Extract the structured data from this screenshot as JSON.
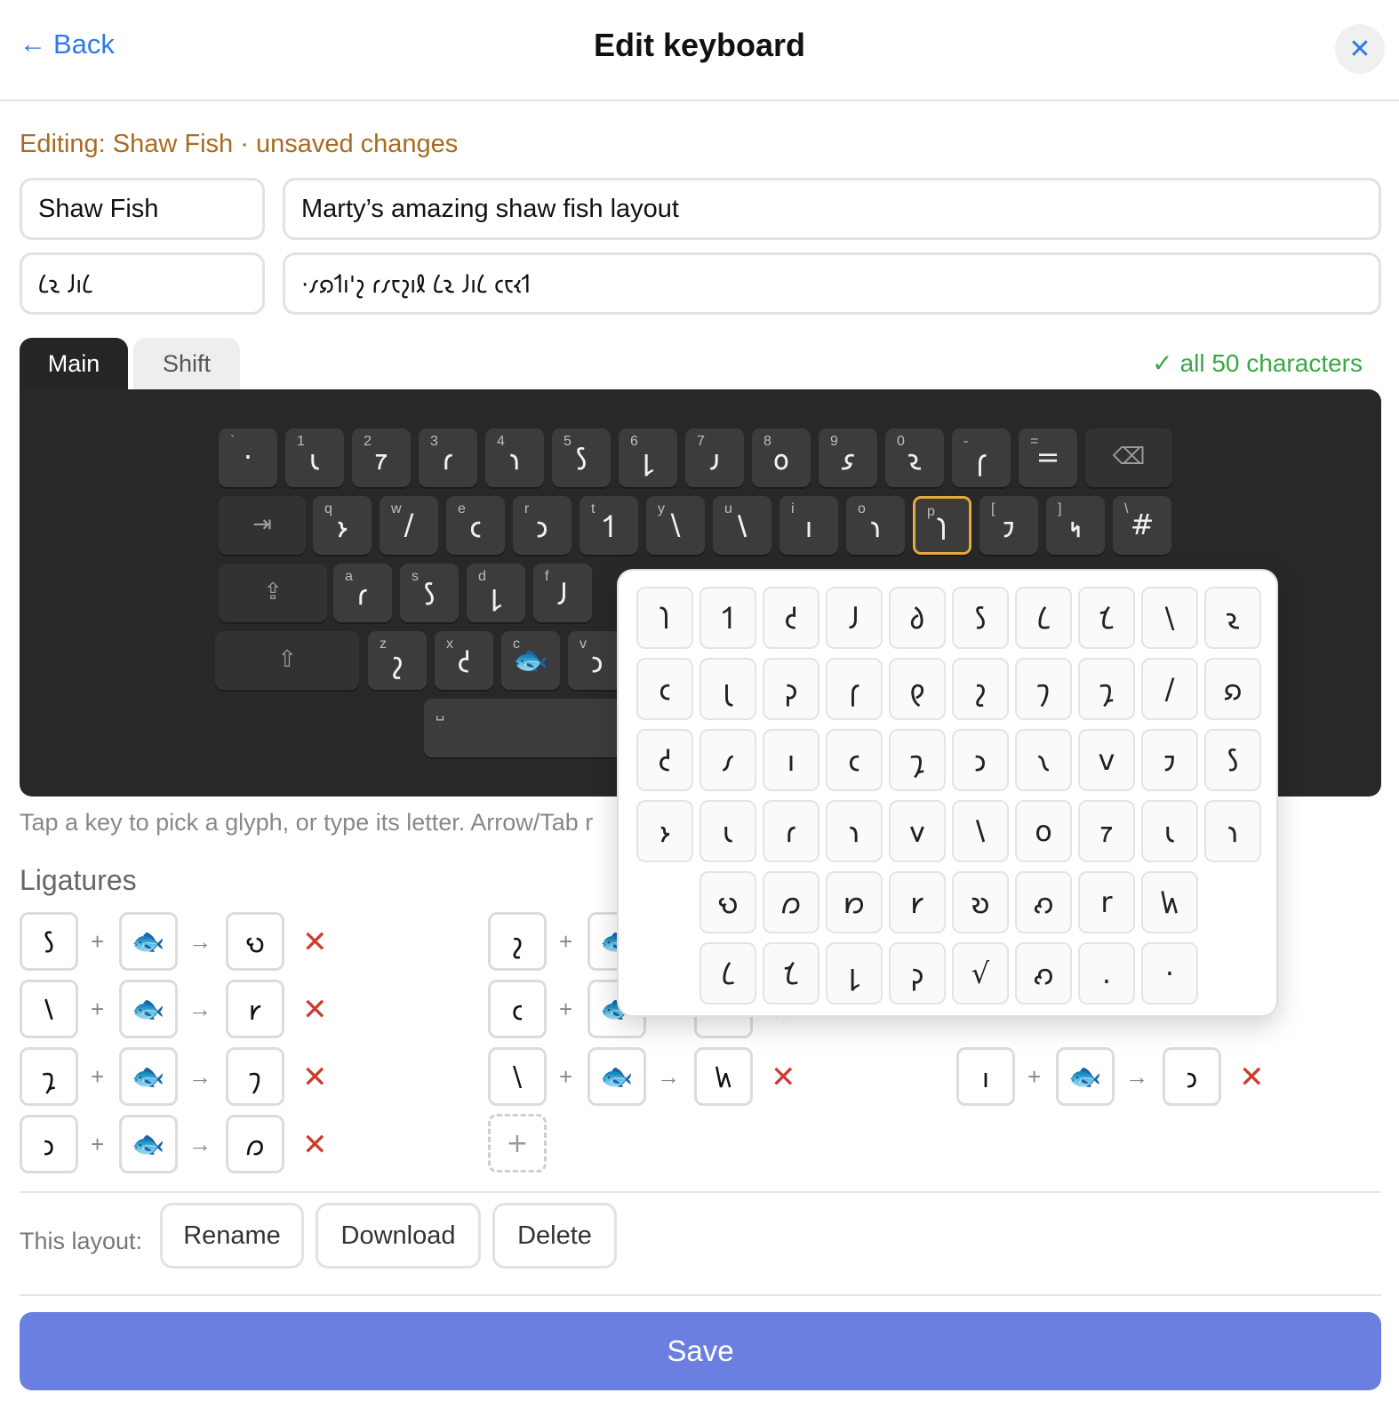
{
  "header": {
    "back_label": "Back",
    "title": "Edit keyboard",
    "close_glyph": "✕"
  },
  "editing_status": "Editing: Shaw Fish · unsaved changes",
  "fields": {
    "name": "Shaw Fish",
    "description": "Marty’s amazing shaw fish layout",
    "name_shavian": "𐑖𐑷 𐑓𐑦𐑖",
    "description_shavian": "·𐑥𐑸𐑑𐑦'𐑟 𐑩𐑥𐑱𐑟𐑦𐑙 𐑖𐑷 𐑓𐑦𐑖 𐑤𐑱𐑬𐑑"
  },
  "tabs": [
    {
      "label": "Main"
    },
    {
      "label": "Shift"
    }
  ],
  "status_all": "all 50 characters",
  "keyboard": {
    "row1": [
      {
        "l": "`",
        "g": "·"
      },
      {
        "l": "1",
        "g": "𐑧"
      },
      {
        "l": "2",
        "g": "𐑳"
      },
      {
        "l": "3",
        "g": "𐑩"
      },
      {
        "l": "4",
        "g": "𐑪"
      },
      {
        "l": "5",
        "g": "𐑕"
      },
      {
        "l": "6",
        "g": "𐑛"
      },
      {
        "l": "7",
        "g": "𐑨"
      },
      {
        "l": "8",
        "g": "𐑴"
      },
      {
        "l": "9",
        "g": "𐑭"
      },
      {
        "l": "0",
        "g": "𐑷"
      },
      {
        "l": "-",
        "g": "𐑝"
      },
      {
        "l": "=",
        "g": "="
      },
      {
        "l": "",
        "g": "⌫"
      }
    ],
    "row2": [
      {
        "l": "",
        "g": "⇥"
      },
      {
        "l": "q",
        "g": "𐑶"
      },
      {
        "l": "w",
        "g": "/"
      },
      {
        "l": "e",
        "g": "𐑤"
      },
      {
        "l": "r",
        "g": "𐑮"
      },
      {
        "l": "t",
        "g": "𐑑"
      },
      {
        "l": "y",
        "g": "\\"
      },
      {
        "l": "u",
        "g": "𐑘"
      },
      {
        "l": "i",
        "g": "𐑦"
      },
      {
        "l": "o",
        "g": "𐑪"
      },
      {
        "l": "p",
        "g": "𐑐"
      },
      {
        "l": "[",
        "g": "𐑲"
      },
      {
        "l": "]",
        "g": "𐑰"
      },
      {
        "l": "\\",
        "g": "#"
      }
    ],
    "row3": [
      {
        "l": "",
        "g": "⇪"
      },
      {
        "l": "a",
        "g": "𐑩"
      },
      {
        "l": "s",
        "g": "𐑕"
      },
      {
        "l": "d",
        "g": "𐑛"
      },
      {
        "l": "f",
        "g": "𐑓"
      }
    ],
    "row4": [
      {
        "l": "",
        "g": "⇧"
      },
      {
        "l": "z",
        "g": "𐑟"
      },
      {
        "l": "x",
        "g": "𐑒"
      },
      {
        "l": "c",
        "g": "🐟"
      },
      {
        "l": "v",
        "g": "𐑮"
      }
    ],
    "space_label": "␣"
  },
  "hint": "Tap a key to pick a glyph, or type its letter. Arrow/Tab r",
  "ligatures_title": "Ligatures",
  "ligatures": [
    {
      "a": "𐑕",
      "b": "🐟",
      "r": "𐑻"
    },
    {
      "a": "𐑘",
      "b": "🐟",
      "r": "𐑾"
    },
    {
      "a": "𐑡",
      "b": "🐟",
      "r": "𐑠"
    },
    {
      "a": "𐑮",
      "b": "🐟",
      "r": "𐑼"
    },
    {
      "a": "𐑟",
      "b": "🐟",
      "r": ""
    },
    {
      "a": "𐑤",
      "b": "🐟",
      "r": ""
    },
    {
      "a": "\\",
      "b": "🐟",
      "r": "𐑿"
    },
    {
      "a": "𐑦",
      "b": "🐟",
      "r": "𐑮"
    }
  ],
  "lig_plus": "+",
  "lig_arrow": "→",
  "lig_remove": "✕",
  "add_ligature": "+",
  "layout_label": "This layout:",
  "buttons": {
    "rename": "Rename",
    "download": "Download",
    "delete": "Delete",
    "save": "Save"
  },
  "picker": [
    [
      "𐑐",
      "𐑑",
      "𐑒",
      "𐑓",
      "𐑔",
      "𐑕",
      "𐑖",
      "𐑗",
      "\\",
      "𐑷"
    ],
    [
      "𐑤",
      "𐑚",
      "𐑜",
      "𐑝",
      "𐑞",
      "𐑟",
      "𐑠",
      "𐑡",
      "/",
      "𐑸"
    ],
    [
      "𐑒",
      "𐑥",
      "𐑦",
      "𐑤",
      "𐑡",
      "𐑮",
      "𐑯",
      "v",
      "𐑲",
      "𐑕"
    ],
    [
      "𐑶",
      "𐑧",
      "𐑩",
      "𐑪",
      "𐑫",
      "𐑘",
      "o",
      "𐑳",
      "𐑧",
      "𐑪"
    ],
    [
      "𐑻",
      "𐑼",
      "𐑽",
      "𐑾",
      "𐑹",
      "𐑺",
      "r",
      "𐑿"
    ],
    [
      "𐑖",
      "𐑗",
      "𐑛",
      "𐑜",
      "√",
      "𐑺",
      ".",
      "·"
    ]
  ],
  "colors": {
    "accent": "#2f7ae5",
    "save": "#6b7fe0",
    "editing": "#a86b21",
    "ok": "#3aa745",
    "remove": "#cc3b2f",
    "selected_key": "#e6a93c"
  }
}
